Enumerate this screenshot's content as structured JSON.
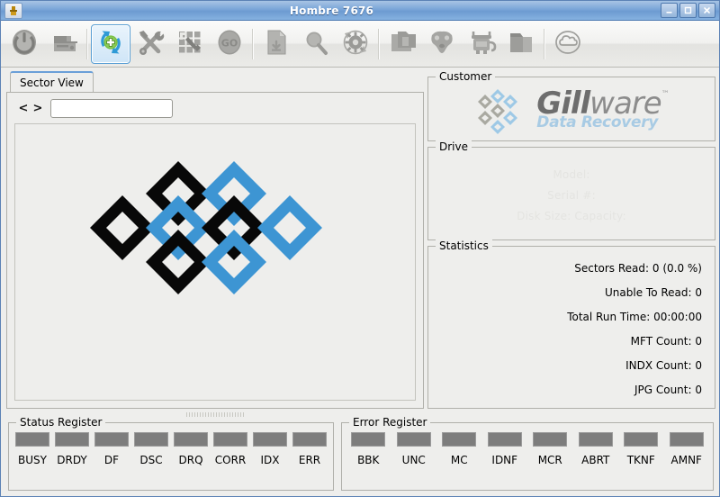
{
  "window": {
    "title": "Hombre 7676",
    "app_icon": "app-icon",
    "minimize_label": "–",
    "maximize_label": "□",
    "close_label": "✕"
  },
  "toolbar": {
    "buttons": [
      {
        "name": "power-button",
        "icon": "power-icon",
        "selected": false,
        "sep_after": false
      },
      {
        "name": "drive-eject-button",
        "icon": "drive-icon",
        "selected": false,
        "sep_after": true
      },
      {
        "name": "refresh-scan-button",
        "icon": "refresh-plus-icon",
        "selected": true,
        "sep_after": false
      },
      {
        "name": "tools-button",
        "icon": "wrench-screwdriver-icon",
        "selected": false,
        "sep_after": false
      },
      {
        "name": "blocks-button",
        "icon": "blocks-icon",
        "selected": false,
        "sep_after": false
      },
      {
        "name": "go-button",
        "icon": "go-icon",
        "selected": false,
        "sep_after": true
      },
      {
        "name": "new-file-button",
        "icon": "file-icon",
        "selected": false,
        "sep_after": false
      },
      {
        "name": "search-button",
        "icon": "magnifier-icon",
        "selected": false,
        "sep_after": false
      },
      {
        "name": "settings-button",
        "icon": "gear-icon",
        "selected": false,
        "sep_after": true
      },
      {
        "name": "copy-files-button",
        "icon": "copy-files-icon",
        "selected": false,
        "sep_after": false
      },
      {
        "name": "mask-button",
        "icon": "mask-icon",
        "selected": false,
        "sep_after": false
      },
      {
        "name": "robot-button",
        "icon": "robot-icon",
        "selected": false,
        "sep_after": false
      },
      {
        "name": "folder-button",
        "icon": "folder-icon",
        "selected": false,
        "sep_after": true
      },
      {
        "name": "cloud-button",
        "icon": "cloud-icon",
        "selected": false,
        "sep_after": false
      }
    ]
  },
  "tabs": [
    {
      "label": "Sector View",
      "active": true
    }
  ],
  "sector_view": {
    "prev_label": "<",
    "next_label": ">",
    "sector_input_value": "",
    "sector_input_placeholder": ""
  },
  "customer": {
    "title": "Customer",
    "logo": {
      "gill": "Gill",
      "ware": "ware",
      "trademark": "™",
      "tagline": "Data Recovery"
    }
  },
  "drive": {
    "title": "Drive",
    "lines": [
      "Model:",
      "Serial #:",
      "Disk Size:    Capacity:"
    ]
  },
  "statistics": {
    "title": "Statistics",
    "lines": [
      "Sectors Read: 0 (0.0 %)",
      "Unable To Read: 0",
      "Total Run Time: 00:00:00",
      "MFT Count: 0",
      "INDX Count: 0",
      "JPG Count: 0"
    ]
  },
  "status_register": {
    "title": "Status Register",
    "flags": [
      "BUSY",
      "DRDY",
      "DF",
      "DSC",
      "DRQ",
      "CORR",
      "IDX",
      "ERR"
    ]
  },
  "error_register": {
    "title": "Error Register",
    "flags": [
      "BBK",
      "UNC",
      "MC",
      "IDNF",
      "MCR",
      "ABRT",
      "TKNF",
      "AMNF"
    ]
  },
  "colors": {
    "diamond_blue": "#3d95d3",
    "diamond_black": "#080808",
    "led_off": "#7d7d7d",
    "titlebar_accent": "#6d9bd1",
    "selected_border": "#5a9fd4",
    "panel_bg": "#eeeeec"
  },
  "diagram": {
    "name": "sector-map-diamonds",
    "tiles": [
      {
        "col": 0,
        "row": 1,
        "color": "#080808"
      },
      {
        "col": 1,
        "row": 0,
        "color": "#080808"
      },
      {
        "col": 1,
        "row": 1,
        "color": "#3d95d3"
      },
      {
        "col": 1,
        "row": 2,
        "color": "#080808"
      },
      {
        "col": 2,
        "row": 0,
        "color": "#3d95d3"
      },
      {
        "col": 2,
        "row": 1,
        "color": "#080808"
      },
      {
        "col": 2,
        "row": 2,
        "color": "#3d95d3"
      },
      {
        "col": 3,
        "row": 1,
        "color": "#3d95d3"
      }
    ]
  }
}
